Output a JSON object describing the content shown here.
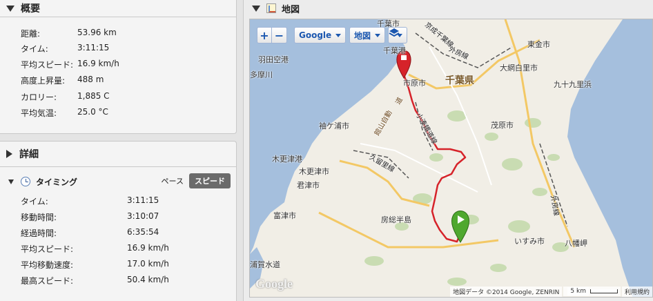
{
  "summary": {
    "title": "概要",
    "rows": [
      {
        "label": "距離:",
        "value": "53.96 km"
      },
      {
        "label": "タイム:",
        "value": "3:11:15"
      },
      {
        "label": "平均スピード:",
        "value": "16.9 km/h"
      },
      {
        "label": "高度上昇量:",
        "value": "488 m"
      },
      {
        "label": "カロリー:",
        "value": "1,885 C"
      },
      {
        "label": "平均気温:",
        "value": "25.0 °C"
      }
    ]
  },
  "details": {
    "title": "詳細",
    "timing": {
      "title": "タイミング",
      "toggle_pace": "ペース",
      "toggle_speed": "スピード",
      "rows": [
        {
          "label": "タイム:",
          "value": "3:11:15"
        },
        {
          "label": "移動時間:",
          "value": "3:10:07"
        },
        {
          "label": "経過時間:",
          "value": "6:35:54"
        },
        {
          "label": "平均スピード:",
          "value": "16.9 km/h"
        },
        {
          "label": "平均移動速度:",
          "value": "17.0 km/h"
        },
        {
          "label": "最高スピード:",
          "value": "50.4 km/h"
        }
      ]
    }
  },
  "map": {
    "title": "地図",
    "zoom_in": "+",
    "zoom_out": "−",
    "provider_label": "Google",
    "map_type_label": "地図",
    "google_logo": "Google",
    "attribution": "地図データ ©2014 Google, ZENRIN",
    "scale": "5 km",
    "terms": "利用規約",
    "places": {
      "chiba_top": "千葉市",
      "chiba_port": "千葉港",
      "haneda": "羽田空港",
      "tamagawa": "多摩川",
      "ichihara": "市原市",
      "chiba_pref": "千葉県",
      "togane": "東金市",
      "oami": "大網白里市",
      "kujukuri": "九十九里浜",
      "sodegaura": "袖ケ浦市",
      "kisarazu_port": "木更津港",
      "kisarazu": "木更津市",
      "kimitsu": "君津市",
      "mobara": "茂原市",
      "futtsu": "富津市",
      "boso": "房総半島",
      "isumi": "いすみ市",
      "hachimanmisaki": "八幡岬",
      "uraga": "浦賀水道",
      "keiyo_line": "京成千葉線",
      "sotobo_line": "外房線",
      "sotobo_line2": "外房線",
      "kominato_line": "小湊鐵道線",
      "kururi_line": "久留里線",
      "tateyama_exp": "館山自動",
      "chiba_exp": "道"
    },
    "colors": {
      "water": "#a5bfdd",
      "route": "#d6232a",
      "land": "#f1eee6"
    }
  }
}
